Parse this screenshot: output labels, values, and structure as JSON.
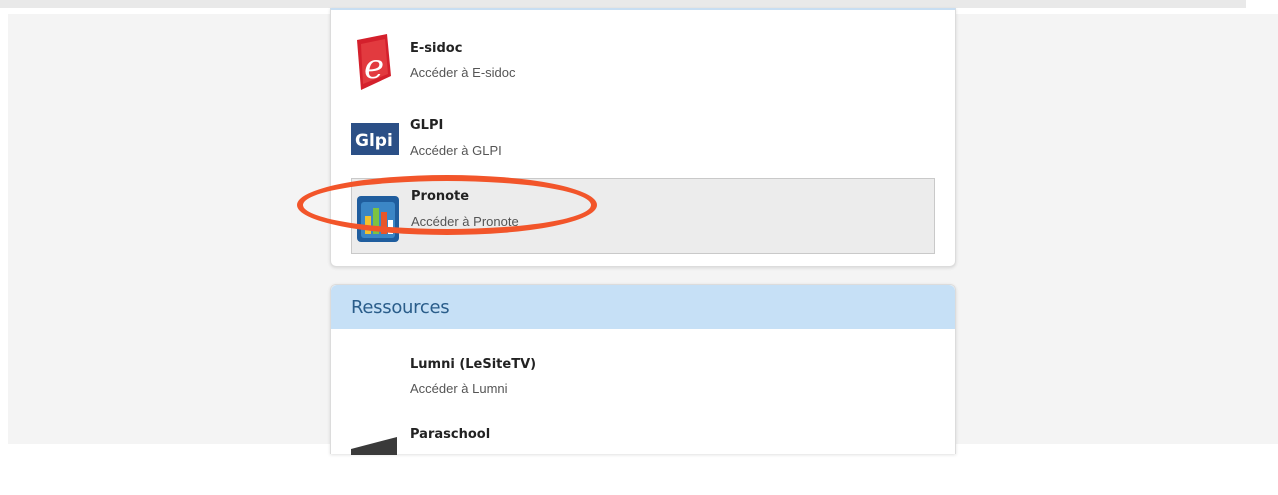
{
  "apps": [
    {
      "title": "E-sidoc",
      "subtitle": "Accéder à E-sidoc",
      "icon": "esidoc-logo-icon"
    },
    {
      "title": "GLPI",
      "subtitle": "Accéder à GLPI",
      "icon": "glpi-logo-icon",
      "logo_text": "Glpi"
    },
    {
      "title": "Pronote",
      "subtitle": "Accéder à Pronote",
      "icon": "pronote-logo-icon",
      "highlighted": true
    }
  ],
  "resources": {
    "header": "Ressources",
    "items": [
      {
        "title": "Lumni (LeSiteTV)",
        "subtitle": "Accéder à Lumni"
      },
      {
        "title": "Paraschool",
        "icon": "paraschool-logo-icon"
      }
    ]
  },
  "colors": {
    "annotation": "#f2552a",
    "header_bg": "#c6e0f6",
    "header_text": "#2a5d8a",
    "esidoc_red": "#d4202c",
    "glpi_blue": "#2b4f86"
  }
}
